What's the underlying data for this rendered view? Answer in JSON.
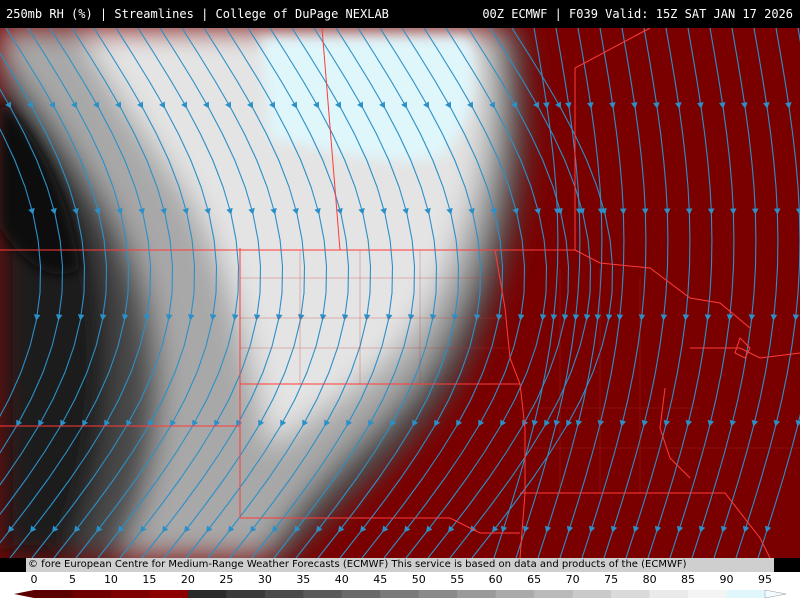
{
  "header": {
    "left_text": "250mb RH (%) | Streamlines | College of DuPage NEXLAB",
    "right_text": "00Z ECMWF | F039 Valid: 15Z SAT JAN 17 2026"
  },
  "attribution": "© fore European Centre for Medium-Range Weather Forecasts (ECMWF)  This service is based on data and products of the (ECMWF)",
  "colorbar": {
    "ticks": [
      "0",
      "5",
      "10",
      "15",
      "20",
      "25",
      "30",
      "35",
      "40",
      "45",
      "50",
      "55",
      "60",
      "65",
      "70",
      "75",
      "80",
      "85",
      "90",
      "95"
    ],
    "colors": [
      "#5a0000",
      "#700000",
      "#7e0000",
      "#8c0000",
      "#2a2a2a",
      "#3a3a3a",
      "#4a4a4a",
      "#5a5a5a",
      "#6a6a6a",
      "#7a7a7a",
      "#8a8a8a",
      "#9a9a9a",
      "#aaaaaa",
      "#bababa",
      "#cacaca",
      "#dadada",
      "#eaeaea",
      "#f4f4f4",
      "#dff6fb"
    ]
  },
  "map_colors": {
    "dry": "#7a0000",
    "streamline": "#2b90c8",
    "border": "#ff3b3b"
  }
}
